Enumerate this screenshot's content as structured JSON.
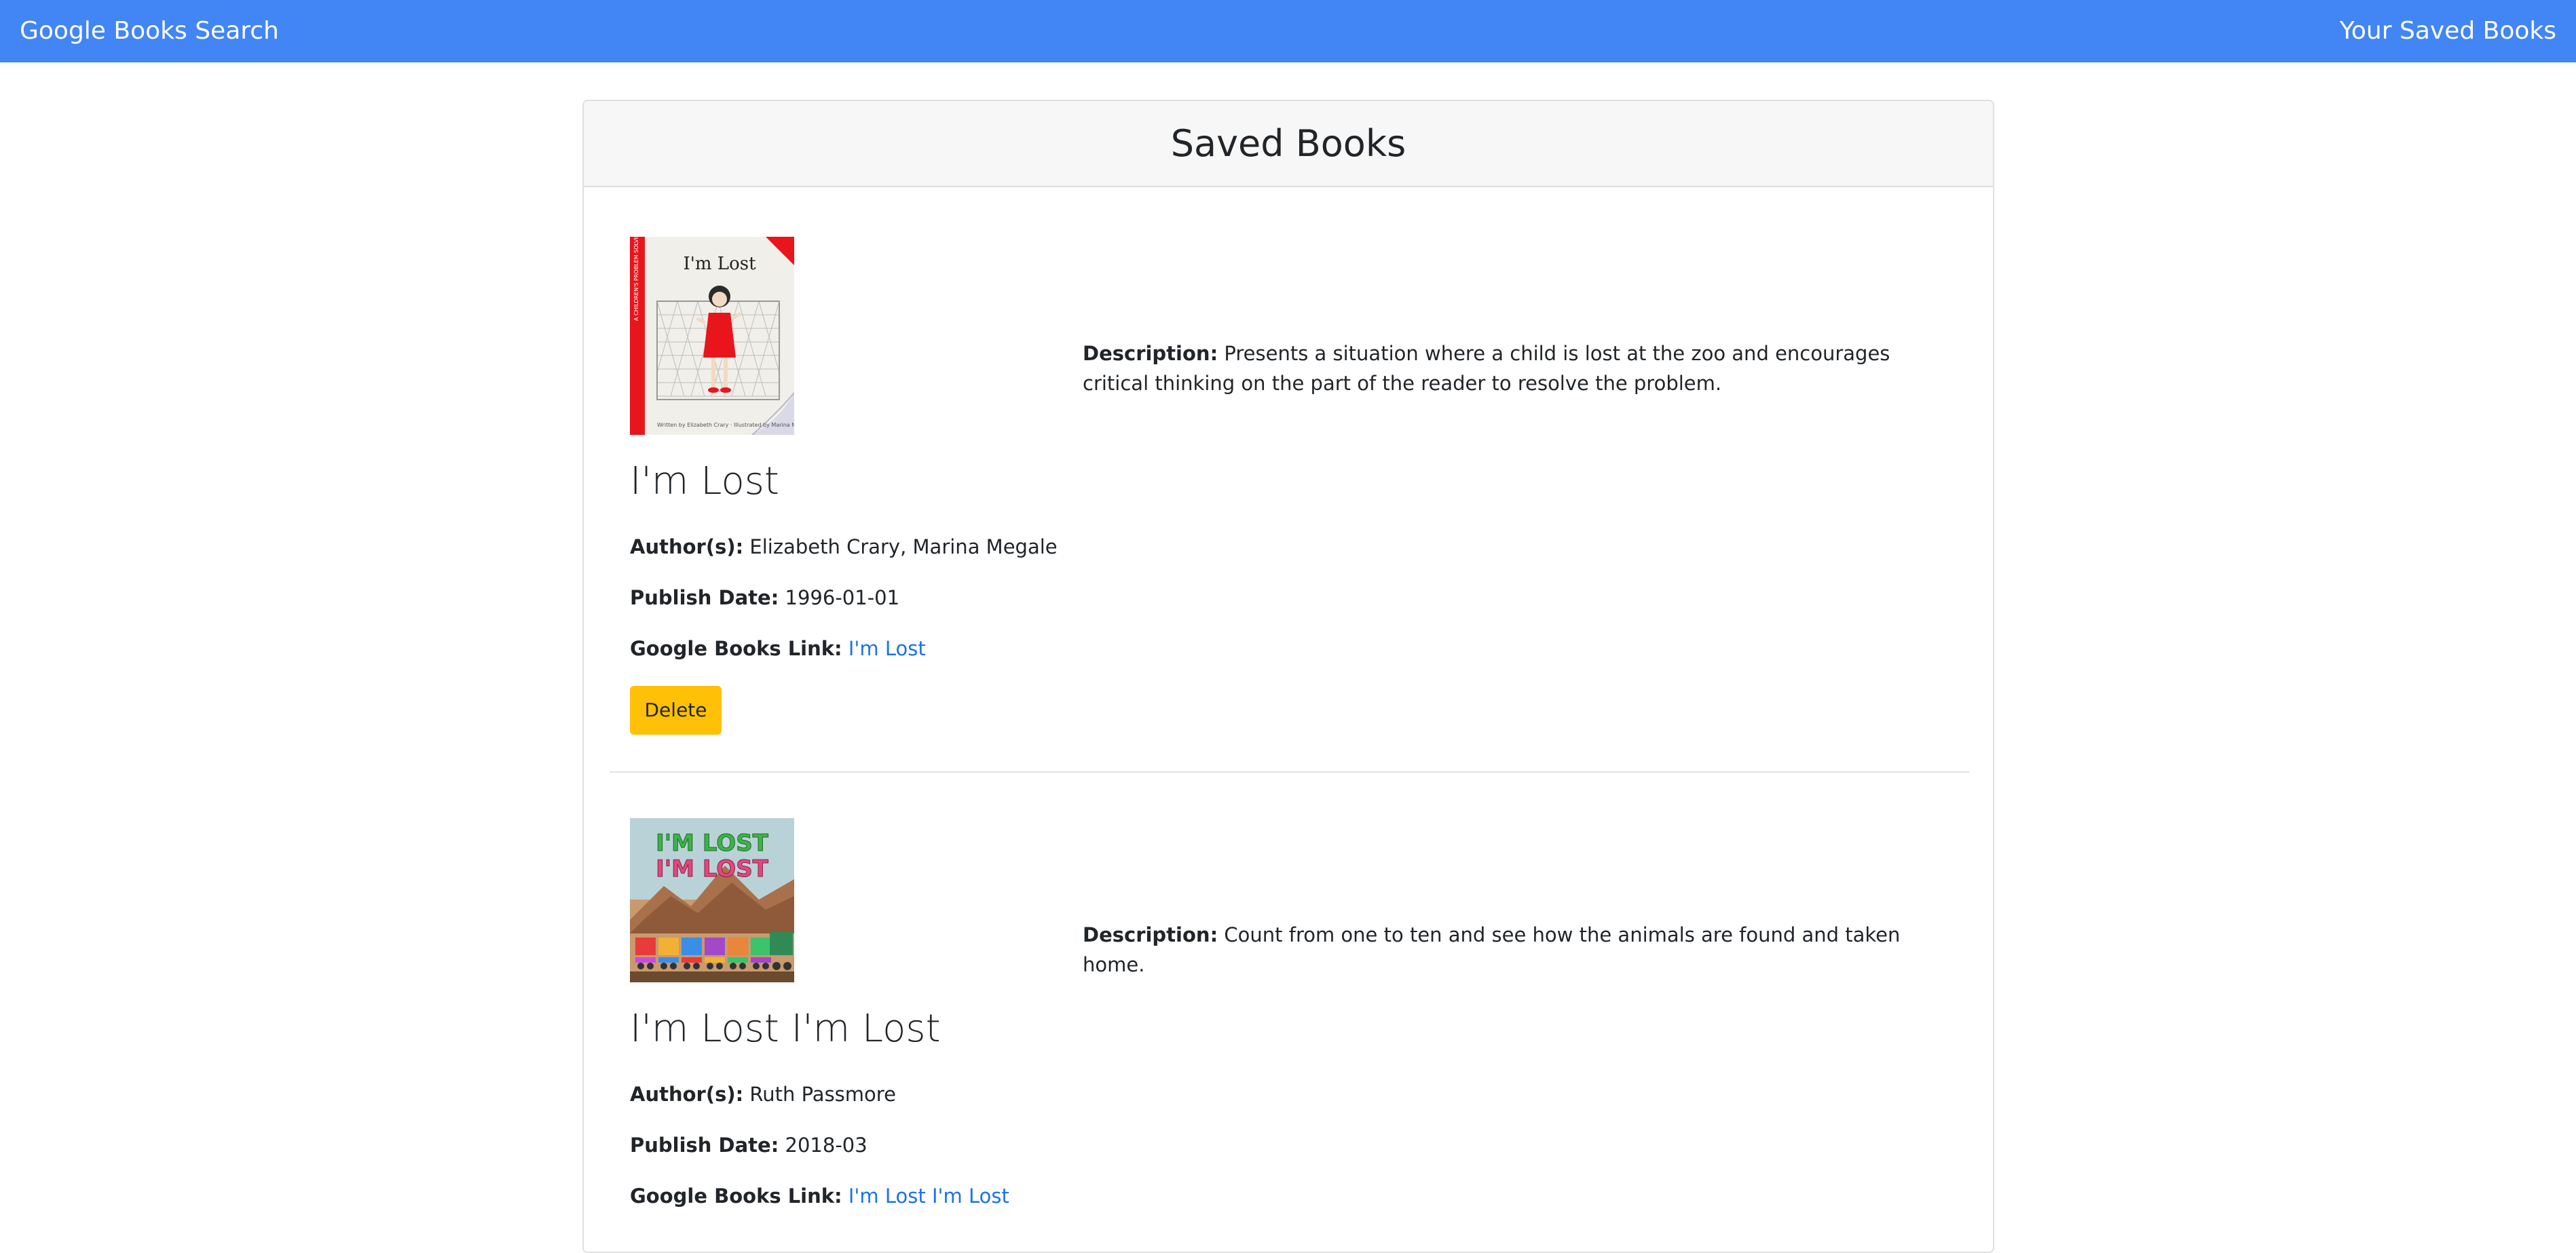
{
  "navbar": {
    "brand": "Google Books Search",
    "saved_link": "Your Saved Books",
    "background_color": "#4285f4"
  },
  "card": {
    "title": "Saved Books"
  },
  "labels": {
    "description": "Description:",
    "authors": "Author(s):",
    "publish_date": "Publish Date:",
    "google_link": "Google Books Link:",
    "delete": "Delete"
  },
  "books": [
    {
      "title": "I'm Lost",
      "authors": "Elizabeth Crary, Marina Megale",
      "publish_date": "1996-01-01",
      "link_text": "I'm Lost",
      "description": "Presents a situation where a child is lost at the zoo and encourages critical thinking on the part of the reader to resolve the problem.",
      "cover_text": "I'm Lost"
    },
    {
      "title": "I'm Lost I'm Lost",
      "authors": "Ruth Passmore",
      "publish_date": "2018-03",
      "link_text": "I'm Lost I'm Lost",
      "description": "Count from one to ten and see how the animals are found and taken home.",
      "cover_text_line1": "I'M LOST",
      "cover_text_line2": "I'M LOST"
    }
  ],
  "colors": {
    "delete_button": "#ffc107",
    "link": "#1a73e8"
  }
}
